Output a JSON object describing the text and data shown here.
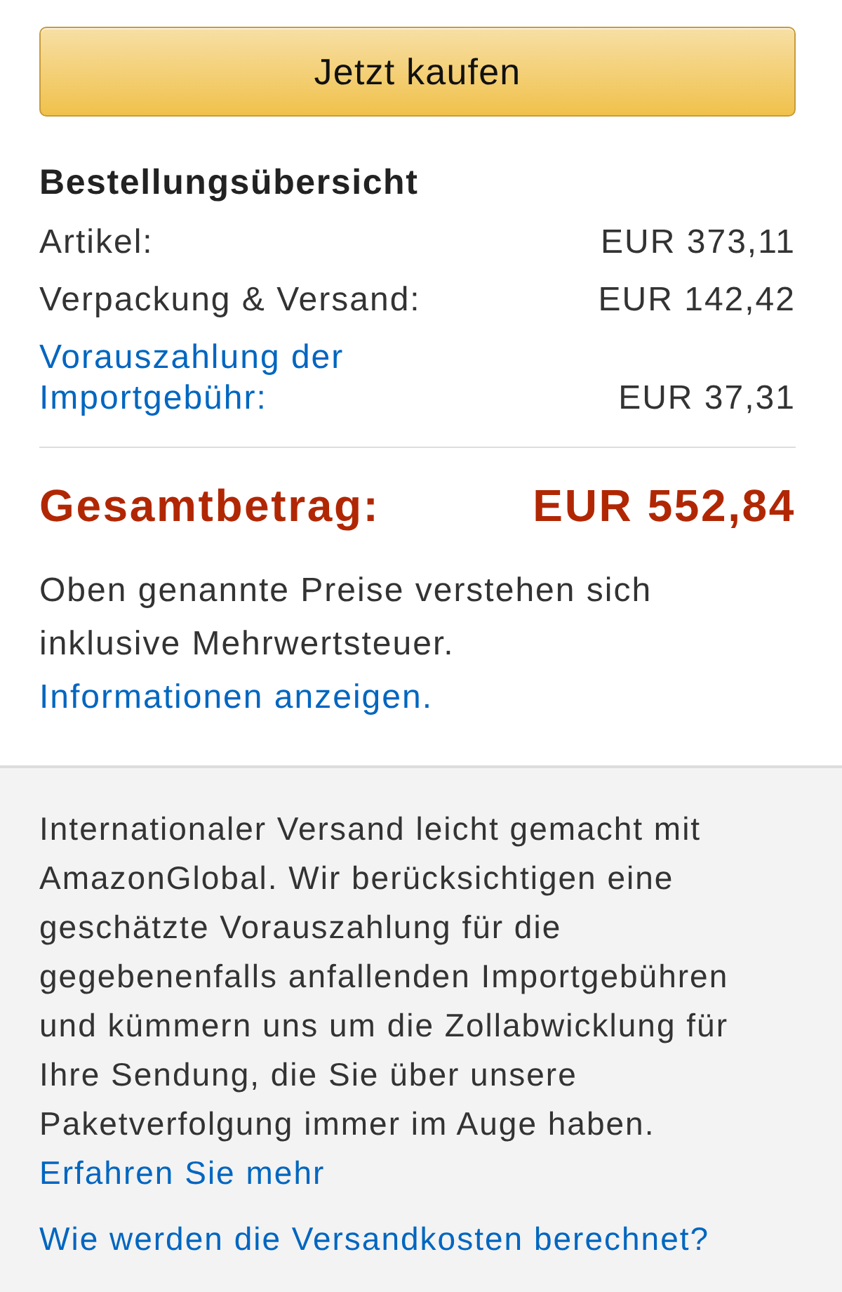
{
  "buy_button": {
    "label": "Jetzt kaufen"
  },
  "order_summary": {
    "title": "Bestellungsübersicht",
    "lines": [
      {
        "kind": "plain",
        "label": "Artikel:",
        "amount": "EUR 373,11"
      },
      {
        "kind": "plain",
        "label": "Verpackung & Versand:",
        "amount": "EUR 142,42"
      },
      {
        "kind": "link",
        "label": "Vorauszahlung der Importgebühr:",
        "amount": "EUR 37,31"
      }
    ],
    "total": {
      "label": "Gesamtbetrag:",
      "amount": "EUR 552,84"
    },
    "vat_note": {
      "text": "Oben genannte Preise verstehen sich inklusive Mehrwertsteuer.",
      "link": "Informationen anzeigen."
    }
  },
  "global_shipping": {
    "text": "Internationaler Versand leicht gemacht mit AmazonGlobal. Wir berücksichtigen eine geschätzte Vorauszahlung für die gegebenenfalls anfallenden Importgebühren und kümmern uns um die Zollabwicklung für Ihre Sendung, die Sie über unsere Paketverfolgung immer im Auge haben.",
    "link": "Erfahren Sie mehr",
    "shipping_cost_link": "Wie werden die Versandkosten berechnet?"
  }
}
